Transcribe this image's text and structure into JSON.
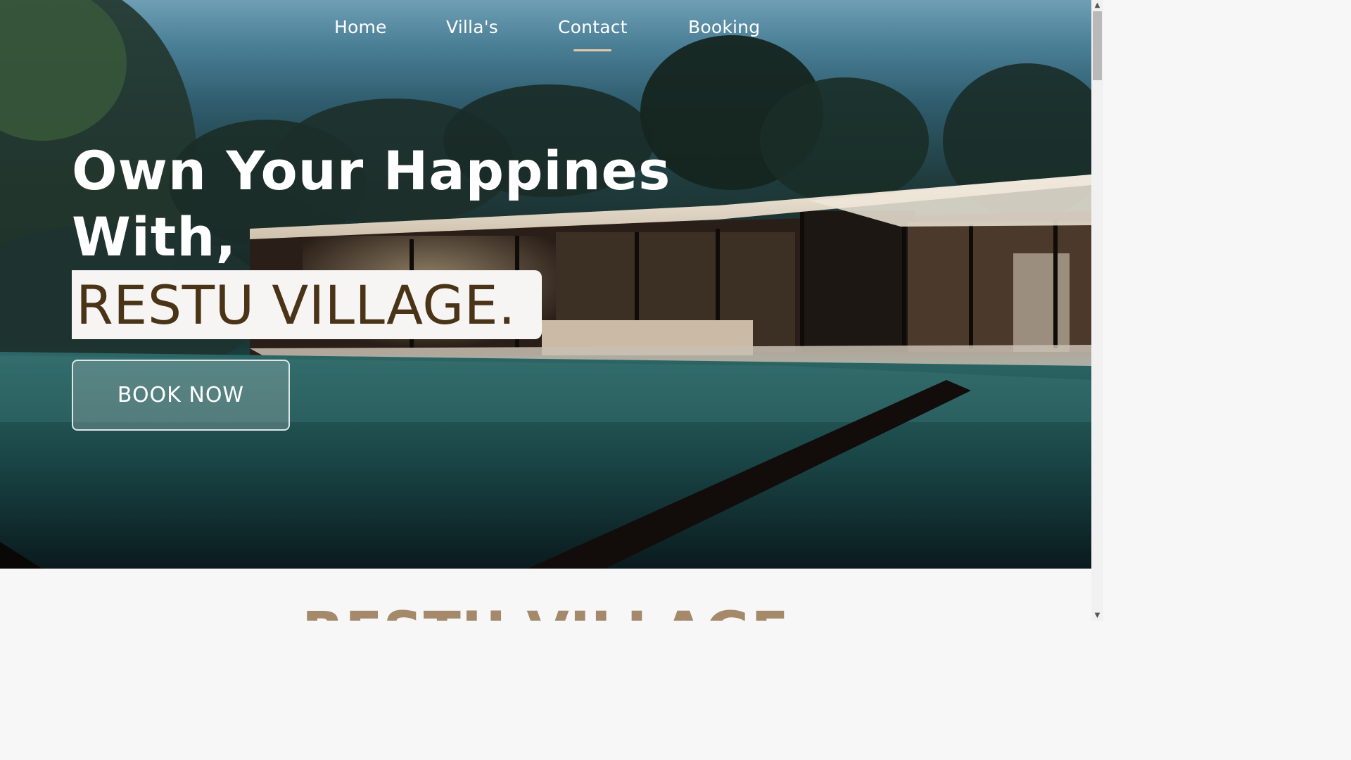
{
  "nav": {
    "items": [
      {
        "label": "Home"
      },
      {
        "label": "Villa's"
      },
      {
        "label": "Contact",
        "active": true
      },
      {
        "label": "Booking"
      }
    ]
  },
  "hero": {
    "headline_line1": "Own Your Happines",
    "headline_line2": "With,",
    "brand": "RESTU VILLAGE.",
    "cta_label": "BOOK NOW",
    "background_image": "modern-villa-with-infinity-pool-at-dusk"
  },
  "section": {
    "title": "RESTU VILLAGE"
  },
  "colors": {
    "accent": "#e3c9a7",
    "brand_text": "#4a3418",
    "section_title": "#a48a6a"
  },
  "scrollbar": {
    "up_icon": "arrow-up-icon",
    "down_icon": "arrow-down-icon"
  }
}
